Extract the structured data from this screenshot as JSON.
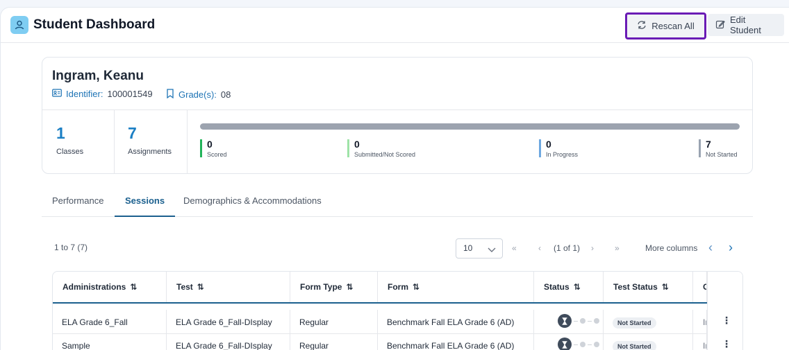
{
  "header": {
    "title": "Student Dashboard",
    "rescan_label": "Rescan All",
    "edit_label": "Edit Student"
  },
  "student": {
    "name": "Ingram, Keanu",
    "identifier_label": "Identifier:",
    "identifier": "100001549",
    "grades_label": "Grade(s):",
    "grades": "08"
  },
  "stats": [
    {
      "value": "1",
      "label": "Classes"
    },
    {
      "value": "7",
      "label": "Assignments"
    }
  ],
  "progress": [
    {
      "value": "0",
      "label": "Scored",
      "color": "#22b45a"
    },
    {
      "value": "0",
      "label": "Submitted/Not Scored",
      "color": "#9ee3a7"
    },
    {
      "value": "0",
      "label": "In Progress",
      "color": "#6ea8e0"
    },
    {
      "value": "7",
      "label": "Not Started",
      "color": "#9aa4b2"
    }
  ],
  "tabs": [
    {
      "label": "Performance",
      "active": false
    },
    {
      "label": "Sessions",
      "active": true
    },
    {
      "label": "Demographics & Accommodations",
      "active": false
    }
  ],
  "pagination": {
    "range": "1 to 7 (7)",
    "page_size": "10",
    "page_info": "(1 of 1)",
    "more_columns": "More columns"
  },
  "table": {
    "columns": [
      "Administrations",
      "Test",
      "Form Type",
      "Form",
      "Status",
      "Test Status",
      "C"
    ],
    "rows": [
      {
        "administration": "ELA Grade 6_Fall",
        "test": "ELA Grade 6_Fall-DIsplay",
        "form_type": "Regular",
        "form": "Benchmark Fall ELA Grade 6 (AD)",
        "test_status": "Not Started",
        "extra": "In"
      },
      {
        "administration": "Sample",
        "test": "ELA Grade 6_Fall-DIsplay",
        "form_type": "Regular",
        "form": "Benchmark Fall ELA Grade 6 (AD)",
        "test_status": "Not Started",
        "extra": "In"
      }
    ]
  }
}
